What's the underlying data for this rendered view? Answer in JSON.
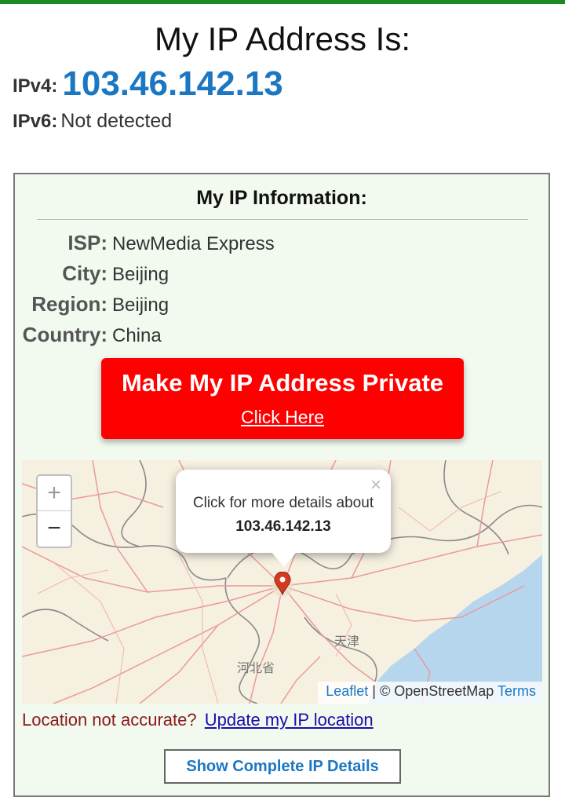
{
  "header": {
    "title": "My IP Address Is:",
    "ipv4_label": "IPv4:",
    "ipv4_value": "103.46.142.13",
    "ipv6_label": "IPv6:",
    "ipv6_value": "Not detected"
  },
  "info": {
    "heading": "My IP Information:",
    "rows": [
      {
        "key": "ISP:",
        "value": "NewMedia Express"
      },
      {
        "key": "City:",
        "value": "Beijing"
      },
      {
        "key": "Region:",
        "value": "Beijing"
      },
      {
        "key": "Country:",
        "value": "China"
      }
    ]
  },
  "cta": {
    "title": "Make My IP Address Private",
    "link": "Click Here"
  },
  "map": {
    "zoom_in": "+",
    "zoom_out": "−",
    "popup_text": "Click for more details about",
    "popup_ip": "103.46.142.13",
    "popup_close": "×",
    "label_tianjin": "天津",
    "label_hebei": "河北省",
    "attrib_leaflet": "Leaflet",
    "attrib_sep": "| © OpenStreetMap",
    "attrib_terms": "Terms"
  },
  "footer": {
    "accuracy_text": "Location not accurate?",
    "accuracy_link": "Update my IP location",
    "details_button": "Show Complete IP Details"
  },
  "colors": {
    "accent_green": "#1f8a1f",
    "ip_blue": "#1c77c3",
    "cta_red": "#ff0000",
    "panel_bg": "#f2f9ef"
  }
}
